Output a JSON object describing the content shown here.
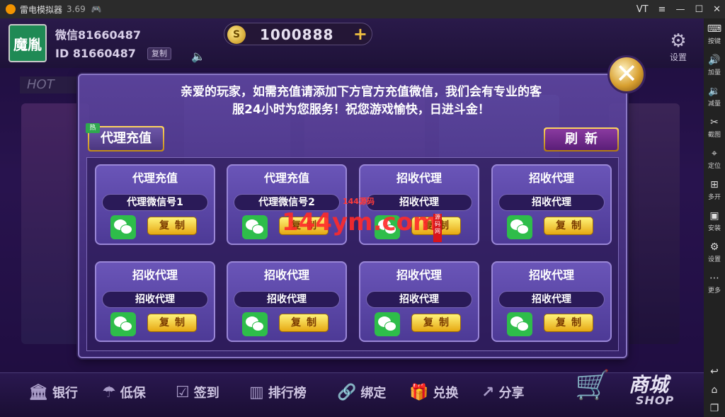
{
  "window": {
    "title": "雷电模拟器",
    "version": "3.69",
    "controls": [
      "VT",
      "≡",
      "—",
      "☐",
      "✕"
    ]
  },
  "sidebar": {
    "items": [
      {
        "label": "按键",
        "icon": "keyboard-icon"
      },
      {
        "label": "加量",
        "icon": "volume-up-icon"
      },
      {
        "label": "减量",
        "icon": "volume-down-icon"
      },
      {
        "label": "截图",
        "icon": "scissors-icon"
      },
      {
        "label": "定位",
        "icon": "location-icon"
      },
      {
        "label": "多开",
        "icon": "multi-open-icon"
      },
      {
        "label": "安装",
        "icon": "apk-install-icon"
      },
      {
        "label": "设置",
        "icon": "gear-icon"
      },
      {
        "label": "更多",
        "icon": "more-icon"
      }
    ],
    "bottom": [
      "back-icon",
      "home-icon",
      "recent-icon"
    ]
  },
  "player": {
    "avatar_text": "魔胤",
    "name": "微信81660487",
    "id_label": "ID",
    "id": "81660487",
    "copy_label": "复制",
    "coins": "1000888"
  },
  "header": {
    "settings_label": "设置",
    "hot_label": "HOT"
  },
  "modal": {
    "notice_line1": "亲爱的玩家，如需充值请添加下方官方充值微信，我们会有专业的客",
    "notice_line2": "服24小时为您服务！祝您游戏愉快，日进斗金！",
    "tab_label": "代理充值",
    "tab_badge": "热",
    "refresh_label": "刷新",
    "cards": [
      {
        "title": "代理充值",
        "field": "代理微信号1",
        "copy": "复制"
      },
      {
        "title": "代理充值",
        "field": "代理微信号2",
        "copy": "复制"
      },
      {
        "title": "招收代理",
        "field": "招收代理",
        "copy": "复制"
      },
      {
        "title": "招收代理",
        "field": "招收代理",
        "copy": "复制"
      },
      {
        "title": "招收代理",
        "field": "招收代理",
        "copy": "复制"
      },
      {
        "title": "招收代理",
        "field": "招收代理",
        "copy": "复制"
      },
      {
        "title": "招收代理",
        "field": "招收代理",
        "copy": "复制"
      },
      {
        "title": "招收代理",
        "field": "招收代理",
        "copy": "复制"
      }
    ]
  },
  "watermark": {
    "main": "144ym.com",
    "small": "144源码",
    "seal": "源码网"
  },
  "bottom_nav": [
    {
      "label": "银行",
      "icon": "bank-icon"
    },
    {
      "label": "低保",
      "icon": "umbrella-icon"
    },
    {
      "label": "签到",
      "icon": "calendar-check-icon"
    },
    {
      "label": "排行榜",
      "icon": "ranking-icon"
    },
    {
      "label": "绑定",
      "icon": "link-icon"
    },
    {
      "label": "兑换",
      "icon": "gift-icon"
    },
    {
      "label": "分享",
      "icon": "share-icon"
    }
  ],
  "shop": {
    "cn": "商城",
    "en": "SHOP"
  },
  "colors": {
    "accent_gold": "#e6a812",
    "modal_purple": "#5a4aa8",
    "wechat_green": "#2ebd4a"
  }
}
